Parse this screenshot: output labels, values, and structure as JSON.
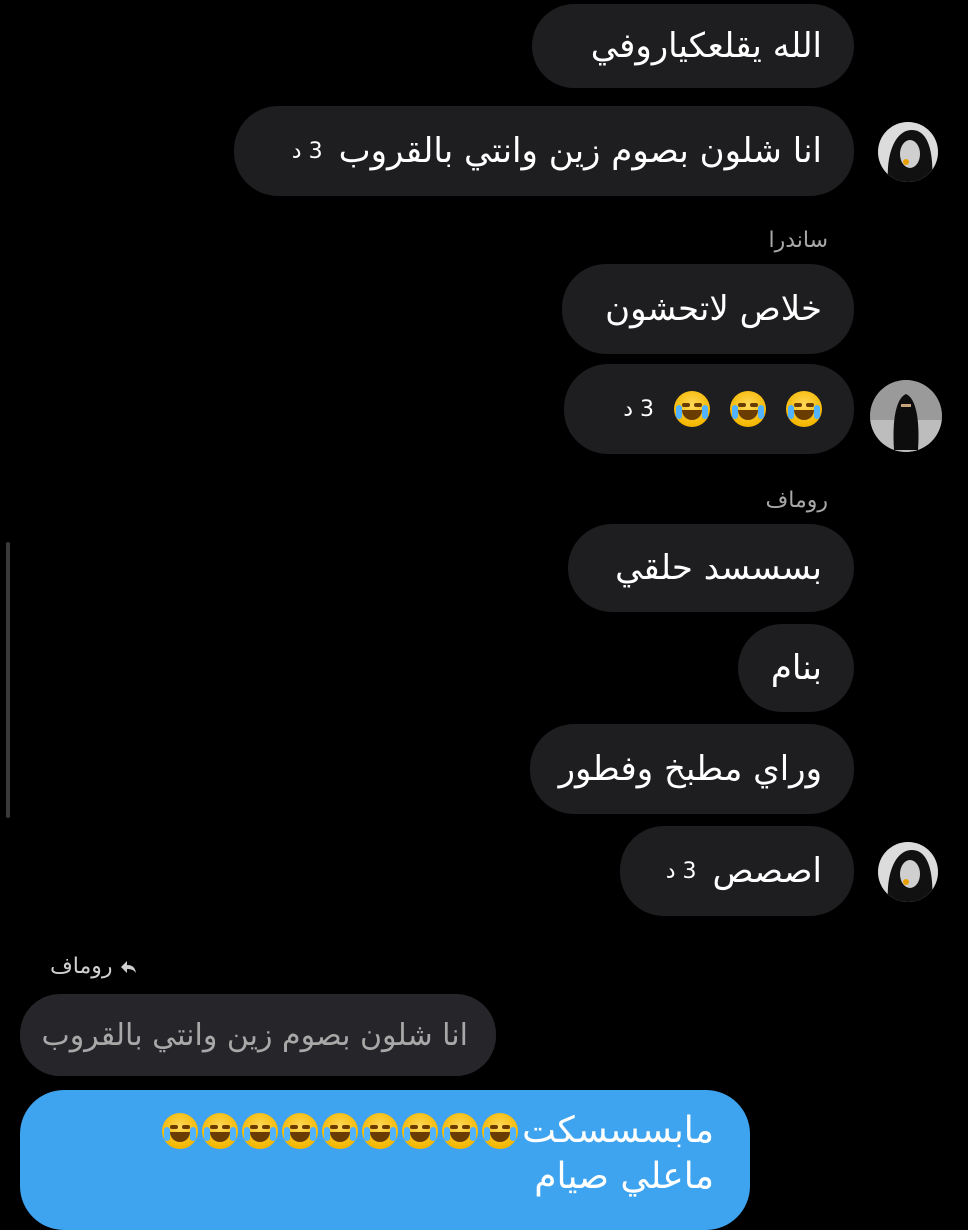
{
  "messages": [
    {
      "text": "الله يقلعكياروفي"
    },
    {
      "text": "انا شلون بصوم زين وانتي بالقروب",
      "time": "3 د"
    },
    {
      "text": "خلاص لاتحشون"
    },
    {
      "text": "😂😂😂",
      "time": "3 د"
    },
    {
      "text": "بسسسد حلقي"
    },
    {
      "text": "بنام"
    },
    {
      "text": "وراي مطبخ وفطور"
    },
    {
      "text": "اصصص",
      "time": "3 د"
    }
  ],
  "senders": {
    "sandra": "ساندرا",
    "romaf": "روماف"
  },
  "reply": {
    "label": "روماف",
    "quoted_text": "انا شلون بصوم زين وانتي بالقروب",
    "out_text_line1": "مابسسسكت",
    "out_text_line2": "ماعلي صيام"
  },
  "colors": {
    "background": "#000000",
    "incoming_bubble": "#1e1e21",
    "outgoing_bubble": "#3ea4ef",
    "secondary_text": "#a8a8a8"
  }
}
